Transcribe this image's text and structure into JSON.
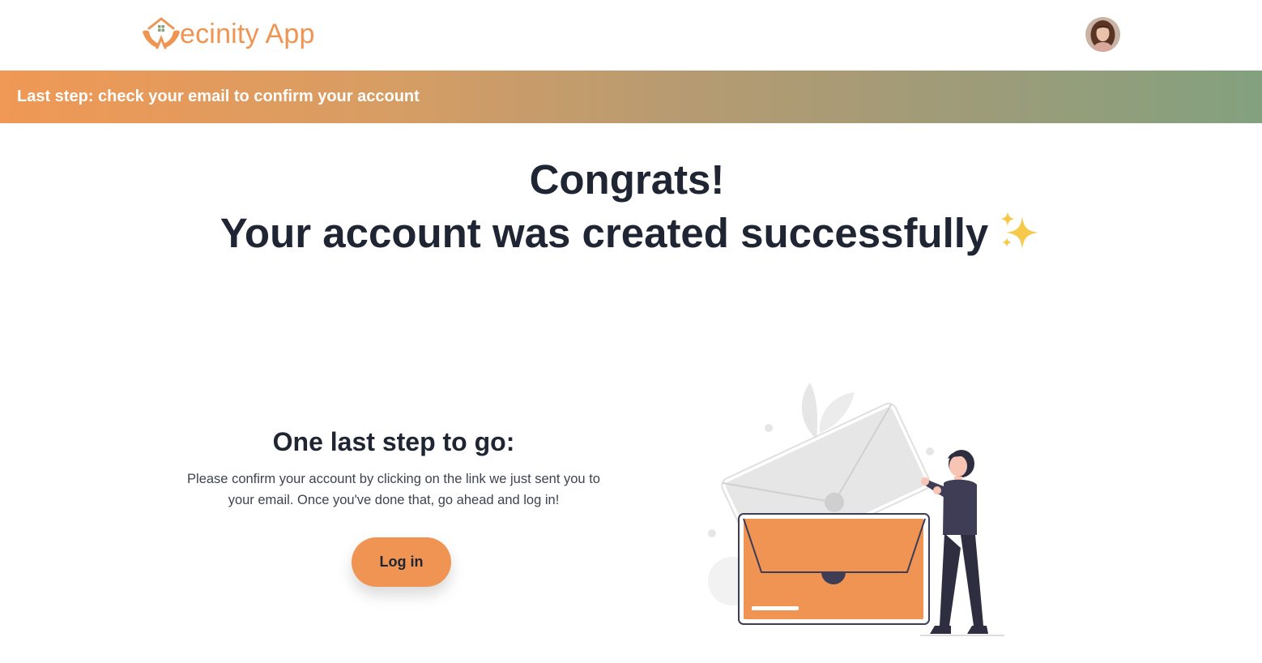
{
  "header": {
    "logo_text": "ecinity App",
    "logo_icon": "house-hands-icon",
    "avatar": "user-avatar"
  },
  "banner": {
    "text": "Last step: check your email to confirm your account"
  },
  "headline": {
    "line1": "Congrats!",
    "line2": "Your account was created successfully",
    "emoji": "sparkles-icon"
  },
  "step": {
    "title": "One last step to go:",
    "description": "Please confirm your account by clicking on the link we just sent you to your email. Once you've done that, go ahead and log in!"
  },
  "login_button": {
    "label": "Log in"
  },
  "colors": {
    "brand_orange": "#ef9452",
    "banner_start": "#f09855",
    "banner_end": "#83a17f",
    "text_dark": "#1f2533",
    "figure_dark": "#3f3d56"
  }
}
